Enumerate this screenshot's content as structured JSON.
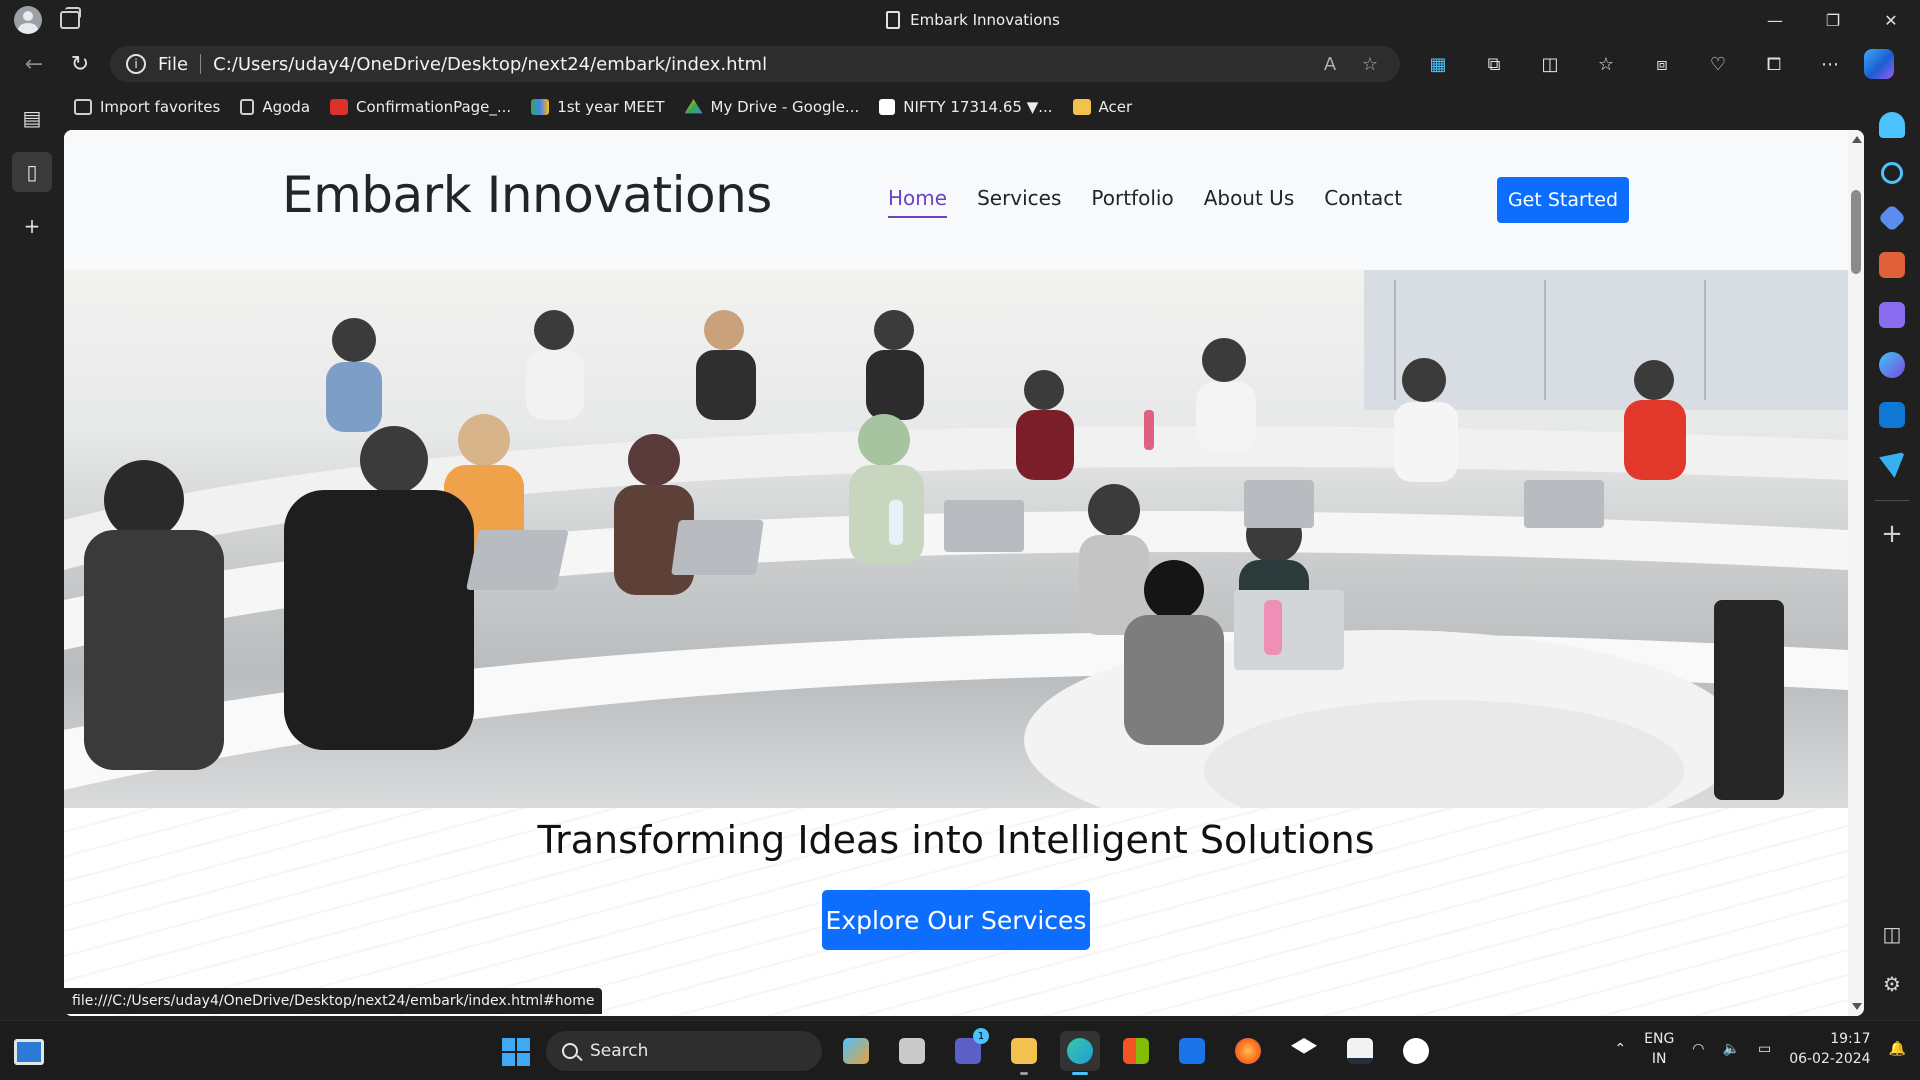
{
  "browser": {
    "window_title": "Embark Innovations",
    "address": {
      "scheme_label": "File",
      "url": "C:/Users/uday4/OneDrive/Desktop/next24/embark/index.html"
    },
    "favorites": [
      {
        "label": "Import favorites",
        "icon": "import-icon",
        "color": "#cfcfcf"
      },
      {
        "label": "Agoda",
        "icon": "page-icon",
        "color": "#cfcfcf"
      },
      {
        "label": "ConfirmationPage_...",
        "icon": "pdf-icon",
        "color": "#d9312b"
      },
      {
        "label": "1st year MEET",
        "icon": "meet-icon",
        "color": "#34a853"
      },
      {
        "label": "My Drive - Google...",
        "icon": "drive-icon",
        "color": "#fbbc04"
      },
      {
        "label": "NIFTY 17314.65 ▼...",
        "icon": "tradingview-icon",
        "color": "#ffffff"
      },
      {
        "label": "Acer",
        "icon": "folder-icon",
        "color": "#f2c14e"
      }
    ],
    "status_url": "file:///C:/Users/uday4/OneDrive/Desktop/next24/embark/index.html#home"
  },
  "site": {
    "brand": "Embark Innovations",
    "nav": [
      "Home",
      "Services",
      "Portfolio",
      "About Us",
      "Contact"
    ],
    "active_nav": "Home",
    "cta": "Get Started",
    "hero_image": "classroom-photo",
    "tagline": "Transforming Ideas into Intelligent Solutions",
    "explore_button": "Explore Our Services",
    "colors": {
      "primary": "#0d6efd",
      "active_nav": "#6f42c1",
      "header_bg": "#f8f9fa"
    }
  },
  "taskbar": {
    "search_placeholder": "Search",
    "teams_badge": "1",
    "language": "ENG",
    "region": "IN",
    "time": "19:17",
    "date": "06-02-2024",
    "apps": [
      {
        "name": "copilot-pre-app",
        "color": "#e6a23c"
      },
      {
        "name": "task-view-app",
        "color": "#c9c9c9"
      },
      {
        "name": "teams-app",
        "color": "#5b5fc7"
      },
      {
        "name": "file-explorer-app",
        "color": "#f2c14e"
      },
      {
        "name": "edge-app",
        "color": "#1ea0d6"
      },
      {
        "name": "microsoft-store-app",
        "color": "#0078d4"
      },
      {
        "name": "mail-app",
        "color": "#1a73e8"
      },
      {
        "name": "firefox-app",
        "color": "#ff6a1a"
      },
      {
        "name": "dropbox-app",
        "color": "#ffffff"
      },
      {
        "name": "amazon-app",
        "color": "#232f3e"
      },
      {
        "name": "messenger-app",
        "color": "#ffffff"
      }
    ]
  }
}
